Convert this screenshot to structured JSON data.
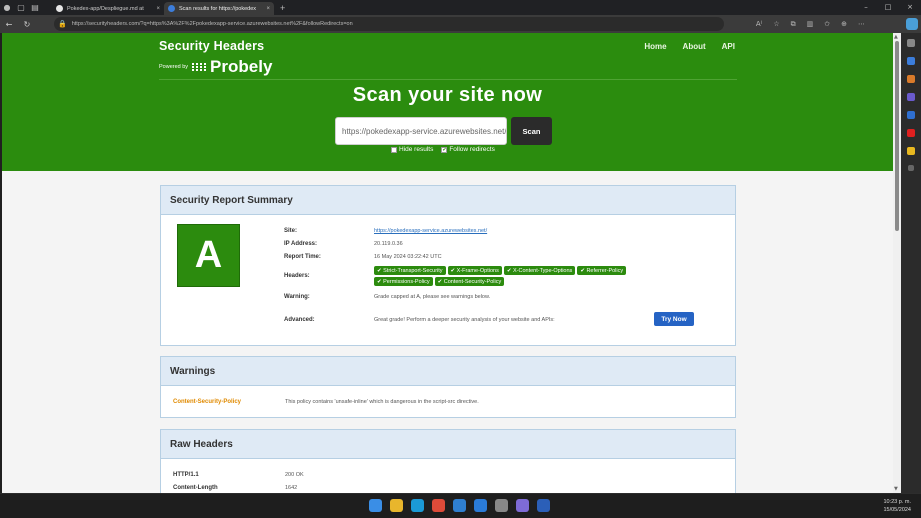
{
  "browser": {
    "tabs": [
      {
        "title": "Pokedex-app/Despliegue.md at",
        "close": "×"
      },
      {
        "title": "Scan results for https://pokedex",
        "close": "×"
      }
    ],
    "new_tab": "+",
    "url": "https://securityheaders.com/?q=https%3A%2F%2Fpokedexapp-service.azurewebsites.net%2F&followRedirects=on",
    "window_controls": [
      "–",
      "□",
      "×"
    ]
  },
  "site": {
    "brand": "Security Headers",
    "powered_by": "Powered by",
    "probely": "Probely",
    "nav": [
      "Home",
      "About",
      "API"
    ],
    "hero_title": "Scan your site now",
    "scan_input_value": "https://pokedexapp-service.azurewebsites.net/",
    "scan_button": "Scan",
    "hide_results": "Hide results",
    "follow_redirects": "Follow redirects"
  },
  "summary": {
    "title": "Security Report Summary",
    "grade": "A",
    "site_label": "Site:",
    "site_value": "https://pokedexapp-service.azurewebsites.net/",
    "ip_label": "IP Address:",
    "ip_value": "20.119.0.36",
    "time_label": "Report Time:",
    "time_value": "16 May 2024 03:22:42 UTC",
    "headers_label": "Headers:",
    "headers": [
      "✔ Strict-Transport-Security",
      "✔ X-Frame-Options",
      "✔ X-Content-Type-Options",
      "✔ Referrer-Policy",
      "✔ Permissions-Policy",
      "✔ Content-Security-Policy"
    ],
    "warning_label": "Warning:",
    "warning_value": "Grade capped at A, please see warnings below.",
    "advanced_label": "Advanced:",
    "advanced_value": "Great grade! Perform a deeper security analysis of your website and APIs:",
    "try_now": "Try Now"
  },
  "warnings": {
    "title": "Warnings",
    "name": "Content-Security-Policy",
    "text": "This policy contains 'unsafe-inline' which is dangerous in the script-src directive."
  },
  "raw_headers": {
    "title": "Raw Headers",
    "rows": [
      {
        "k": "HTTP/1.1",
        "v": "200 OK"
      },
      {
        "k": "Content-Length",
        "v": "1642"
      }
    ]
  },
  "taskbar": {
    "time": "10:23 p. m.",
    "date": "15/05/2024"
  },
  "colors": {
    "hero_green": "#2b8c0e",
    "grade_green": "#2c8b0e",
    "card_header": "#dfeaf5",
    "warning_orange": "#e08a00",
    "button_blue": "#2563c4"
  }
}
